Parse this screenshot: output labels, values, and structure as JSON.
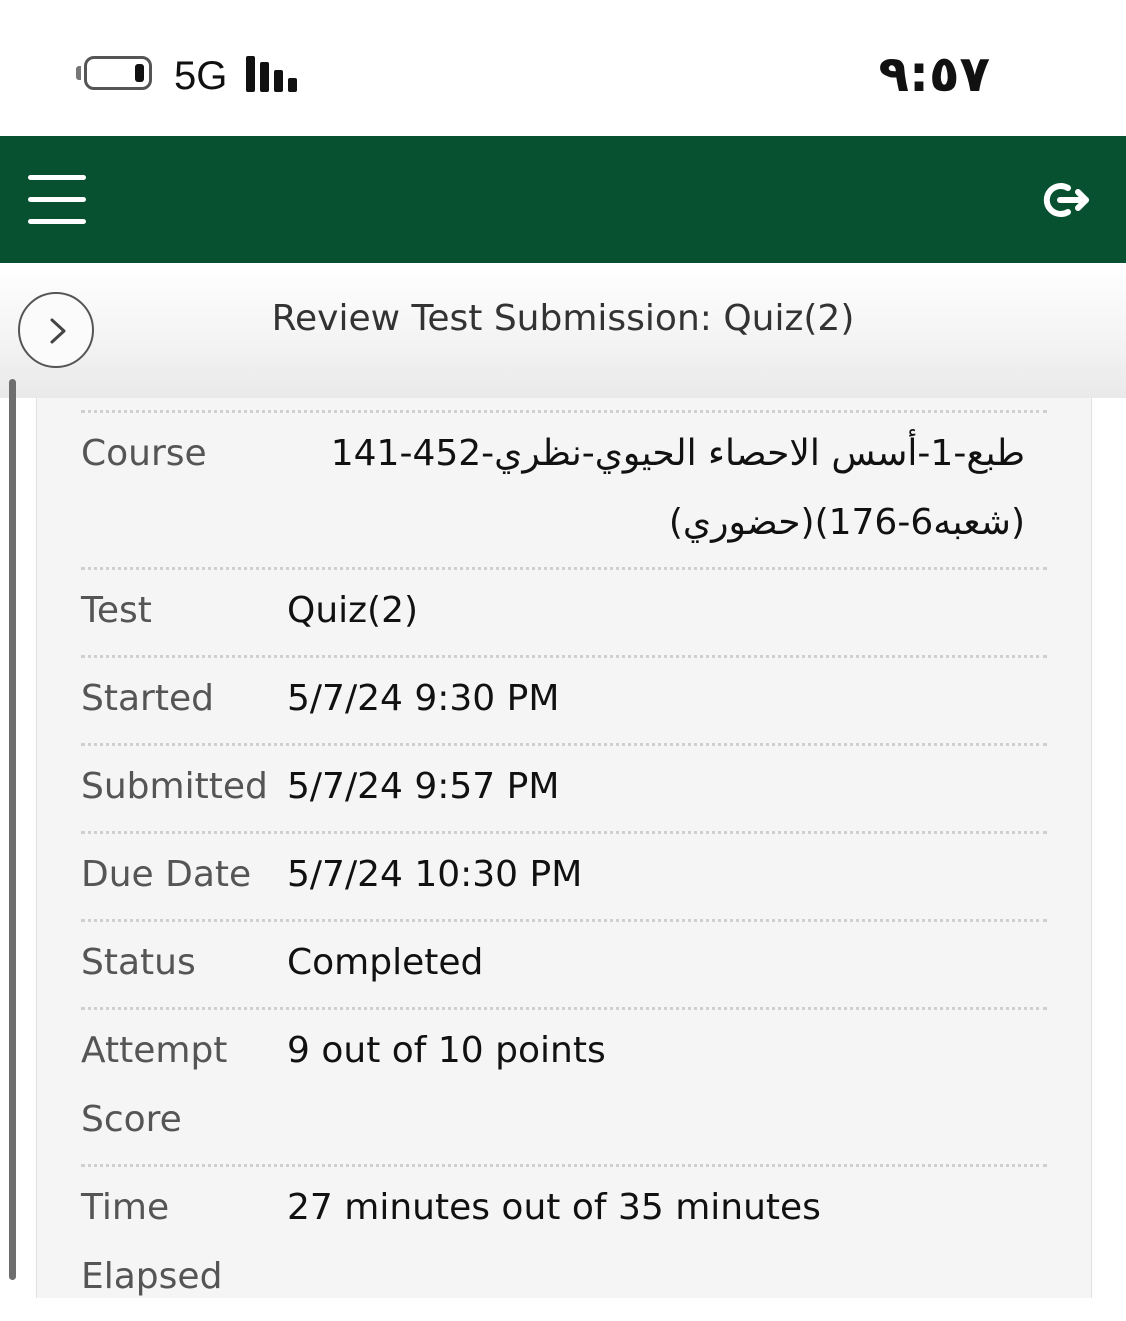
{
  "status_bar": {
    "network": "5G",
    "time": "٩:٥٧"
  },
  "header": {
    "menu_icon": "hamburger-menu-icon",
    "logout_icon": "logout-icon",
    "brand_color": "#075130"
  },
  "page": {
    "title": "Review Test Submission: Quiz(2)",
    "expand_icon": "chevron-right-icon"
  },
  "details": [
    {
      "label": "Course",
      "value": "طبع-1-أسس الاحصاء الحيوي-نظري-452-141 (شعبه6-176)(حضوري)"
    },
    {
      "label": "Test",
      "value": "Quiz(2)"
    },
    {
      "label": "Started",
      "value": "5/7/24 9:30 PM"
    },
    {
      "label": "Submitted",
      "value": "5/7/24 9:57 PM"
    },
    {
      "label": "Due Date",
      "value": "5/7/24 10:30 PM"
    },
    {
      "label": "Status",
      "value": "Completed"
    },
    {
      "label": "Attempt Score",
      "value": "9 out of 10 points"
    },
    {
      "label": "Time Elapsed",
      "value": "27 minutes out of 35 minutes"
    }
  ]
}
